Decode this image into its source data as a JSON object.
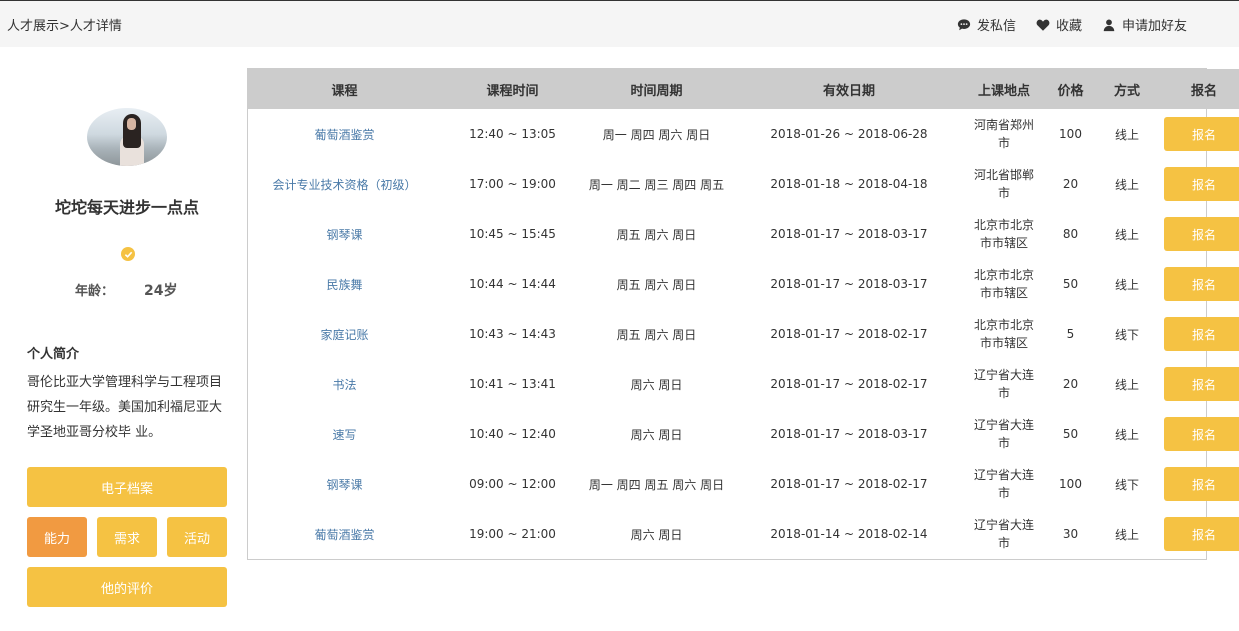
{
  "header": {
    "breadcrumb": "人才展示>人才详情",
    "actions": [
      {
        "label": "发私信",
        "icon": "message-icon"
      },
      {
        "label": "收藏",
        "icon": "heart-icon"
      },
      {
        "label": "申请加好友",
        "icon": "user-icon"
      }
    ]
  },
  "profile": {
    "name": "坨坨每天进步一点点",
    "age_label": "年龄：",
    "age_value": "24岁",
    "bio_title": "个人简介",
    "bio_text": "哥伦比亚大学管理科学与工程项目研究生一年级。美国加利福尼亚大学圣地亚哥分校毕 业。"
  },
  "sidebar_buttons": {
    "archive": "电子档案",
    "ability": "能力",
    "demand": "需求",
    "activity": "活动",
    "reviews": "他的评价"
  },
  "colors": {
    "accent": "#f5c243",
    "active": "#f19a41",
    "link": "#4a7aa8",
    "header_bg": "#cccccc"
  },
  "table": {
    "headers": [
      "课程",
      "课程时间",
      "时间周期",
      "有效日期",
      "上课地点",
      "价格",
      "方式",
      "报名"
    ],
    "rows": [
      {
        "course": "葡萄酒鉴赏",
        "time": "12:40 ~ 13:05",
        "period": "周一 周四 周六 周日",
        "dates": "2018-01-26 ~ 2018-06-28",
        "location": "河南省郑州市",
        "price": "100",
        "mode": "线上",
        "enroll": "报名"
      },
      {
        "course": "会计专业技术资格（初级）",
        "time": "17:00 ~ 19:00",
        "period": "周一 周二 周三 周四 周五",
        "dates": "2018-01-18 ~ 2018-04-18",
        "location": "河北省邯郸市",
        "price": "20",
        "mode": "线上",
        "enroll": "报名"
      },
      {
        "course": "钢琴课",
        "time": "10:45 ~ 15:45",
        "period": "周五 周六 周日",
        "dates": "2018-01-17 ~ 2018-03-17",
        "location": "北京市北京市市辖区",
        "price": "80",
        "mode": "线上",
        "enroll": "报名"
      },
      {
        "course": "民族舞",
        "time": "10:44 ~ 14:44",
        "period": "周五 周六 周日",
        "dates": "2018-01-17 ~ 2018-03-17",
        "location": "北京市北京市市辖区",
        "price": "50",
        "mode": "线上",
        "enroll": "报名"
      },
      {
        "course": "家庭记账",
        "time": "10:43 ~ 14:43",
        "period": "周五 周六 周日",
        "dates": "2018-01-17 ~ 2018-02-17",
        "location": "北京市北京市市辖区",
        "price": "5",
        "mode": "线下",
        "enroll": "报名"
      },
      {
        "course": "书法",
        "time": "10:41 ~ 13:41",
        "period": "周六 周日",
        "dates": "2018-01-17 ~ 2018-02-17",
        "location": "辽宁省大连市",
        "price": "20",
        "mode": "线上",
        "enroll": "报名"
      },
      {
        "course": "速写",
        "time": "10:40 ~ 12:40",
        "period": "周六 周日",
        "dates": "2018-01-17 ~ 2018-03-17",
        "location": "辽宁省大连市",
        "price": "50",
        "mode": "线上",
        "enroll": "报名"
      },
      {
        "course": "钢琴课",
        "time": "09:00 ~ 12:00",
        "period": "周一 周四 周五 周六 周日",
        "dates": "2018-01-17 ~ 2018-02-17",
        "location": "辽宁省大连市",
        "price": "100",
        "mode": "线下",
        "enroll": "报名"
      },
      {
        "course": "葡萄酒鉴赏",
        "time": "19:00 ~ 21:00",
        "period": "周六 周日",
        "dates": "2018-01-14 ~ 2018-02-14",
        "location": "辽宁省大连市",
        "price": "30",
        "mode": "线上",
        "enroll": "报名"
      }
    ]
  }
}
